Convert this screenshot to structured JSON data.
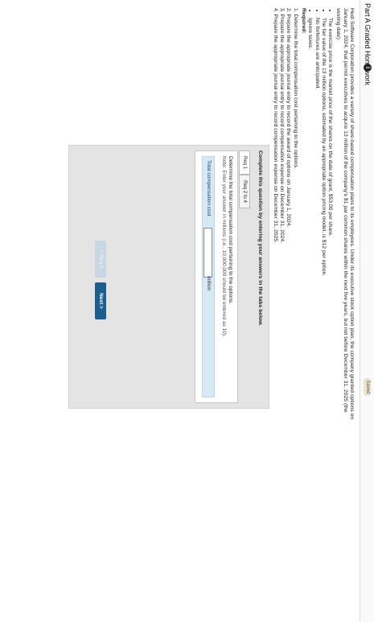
{
  "header": {
    "title": "Part A Graded Homework",
    "info_icon": "i",
    "saved_label": "Saved"
  },
  "problem": {
    "intro": "Hedi Software Corporation provides a variety of share-based compensation plans to its employees. Under its executive stock option plan, the company granted options on January 1, 2024, that permit executives to acquire 13 million of the company's $1 par common shares within the next five years, but not before December 31, 2025 (the vesting date).",
    "bullets": [
      "The exercise price is the market price of the shares on the date of grant, $53.00 per share.",
      "The fair value of the 13 million options, estimated by an appropriate option pricing model, is $12 per option.",
      "No forfeitures are anticipated.",
      "Ignore taxes."
    ],
    "required_label": "Required:",
    "requirements": [
      "1. Determine the total compensation cost pertaining to the options.",
      "2. Prepare the appropriate journal entry to record the award of options on January 1, 2024.",
      "3. Prepare the appropriate journal entry to record compensation expense on December 31, 2024.",
      "4. Prepare the appropriate journal entry to record compensation expense on December 31, 2025."
    ]
  },
  "panel": {
    "heading": "Complete this question by entering your answers in the tabs below.",
    "tabs": [
      "Req 1",
      "Req 2 to 4"
    ],
    "instruction": "Determine the total compensation cost pertaining to the options.",
    "note": "Note: Enter your answer in millions (i.e., 10,000,000 should be entered as 10).",
    "row_label": "Total compensation cost",
    "input_value": "",
    "unit": "million",
    "prev_label": "< Req 1",
    "next_label": "Next >"
  },
  "colors": {
    "next_button": "#1c5f8f",
    "highlight_row": "#d7e9f4",
    "panel_bg": "#e4e4e4"
  }
}
